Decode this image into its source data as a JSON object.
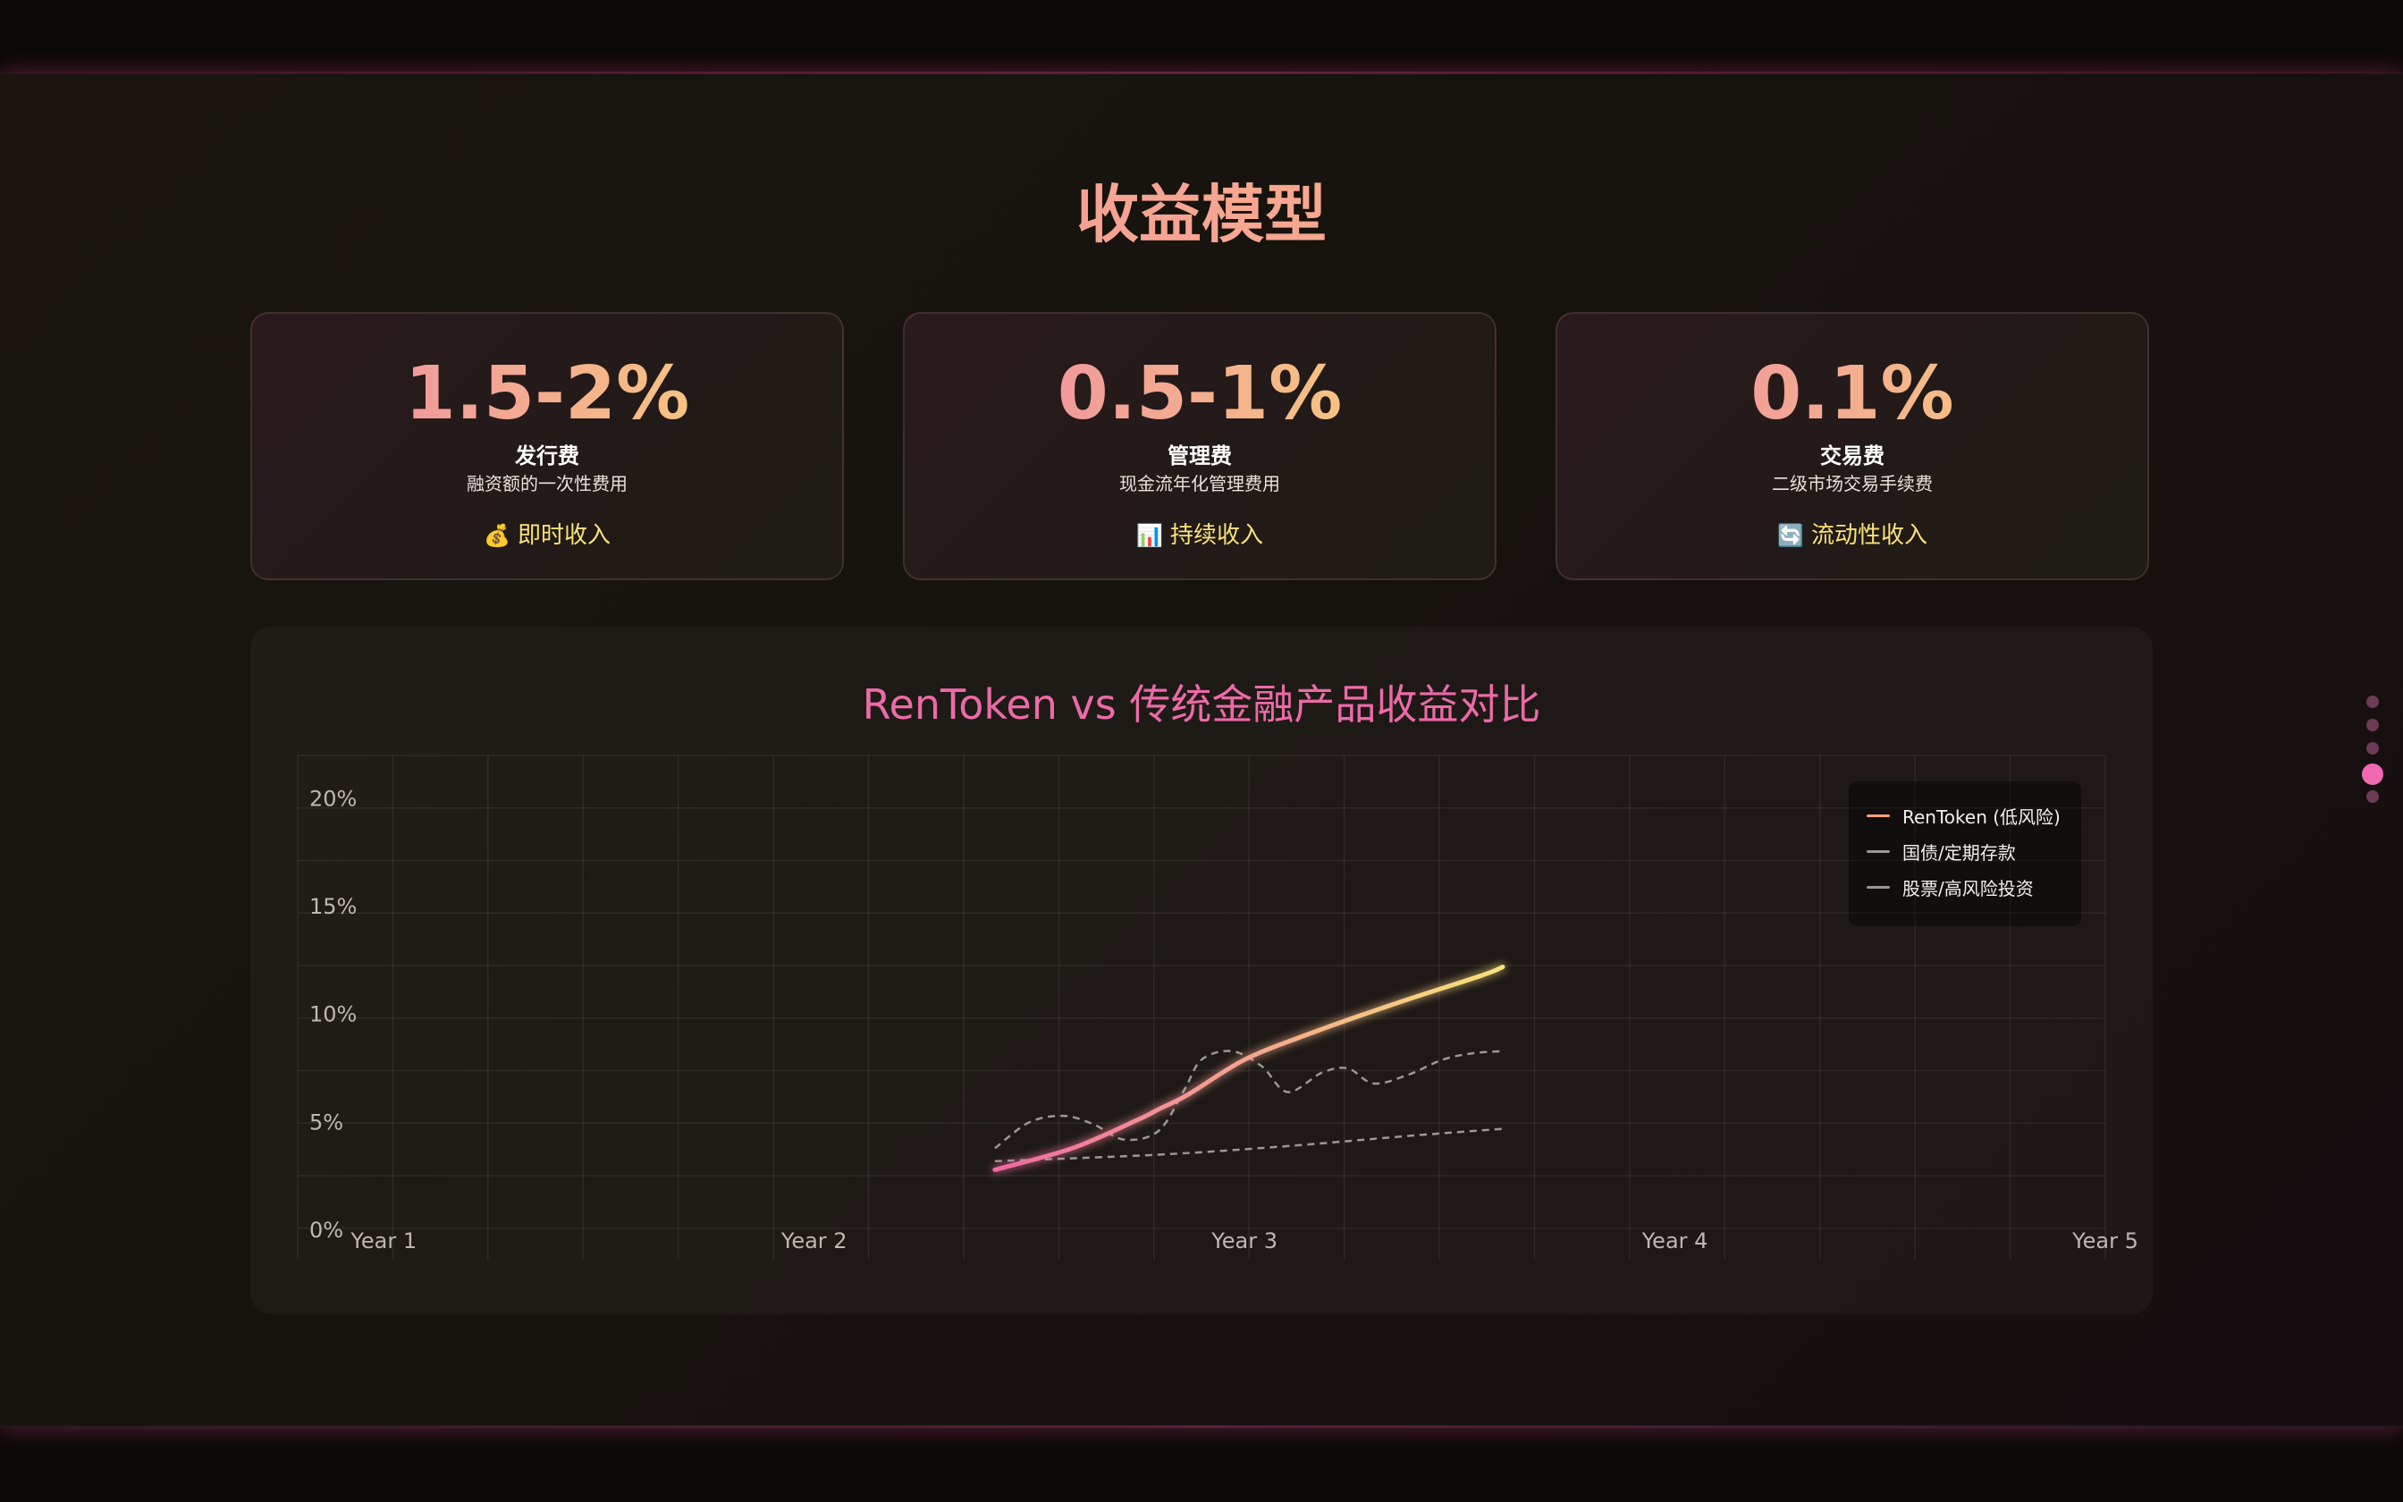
{
  "page": {
    "title": "收益模型"
  },
  "cards": [
    {
      "value": "1.5-2%",
      "name": "发行费",
      "desc": "融资额的一次性费用",
      "tag_icon": "💰",
      "tag": "即时收入"
    },
    {
      "value": "0.5-1%",
      "name": "管理费",
      "desc": "现金流年化管理费用",
      "tag_icon": "📊",
      "tag": "持续收入"
    },
    {
      "value": "0.1%",
      "name": "交易费",
      "desc": "二级市场交易手续费",
      "tag_icon": "🔄",
      "tag": "流动性收入"
    }
  ],
  "chart_data": {
    "type": "line",
    "title": "RenToken vs 传统金融产品收益对比",
    "x_ticks": [
      "Year 1",
      "Year 2",
      "Year 3",
      "Year 4",
      "Year 5"
    ],
    "y_ticks": [
      "0%",
      "5%",
      "10%",
      "15%",
      "20%"
    ],
    "ylim": [
      0,
      22
    ],
    "grid": true,
    "legend_position": "top-right",
    "series": [
      {
        "name": "RenToken (低风险)",
        "color": "#f6a07a",
        "gradient": [
          "#f06aa2",
          "#f9e27a"
        ],
        "dashed": false,
        "x": [
          2.42,
          2.6,
          2.75,
          2.8,
          2.87,
          3.0,
          3.15,
          3.35,
          3.55,
          3.6
        ],
        "y": [
          2.8,
          3.8,
          5.1,
          5.6,
          6.3,
          7.9,
          9.1,
          10.5,
          11.8,
          12.2
        ]
      },
      {
        "name": "国债/定期存款",
        "color": "#9a9894",
        "dashed": true,
        "x": [
          2.42,
          2.8,
          3.1,
          3.4,
          3.6
        ],
        "y": [
          3.2,
          3.5,
          3.9,
          4.4,
          4.7
        ]
      },
      {
        "name": "股票/高风险投资",
        "color": "#9a9894",
        "dashed": true,
        "x": [
          2.42,
          2.5,
          2.58,
          2.65,
          2.72,
          2.8,
          2.86,
          2.9,
          2.97,
          3.04,
          3.1,
          3.18,
          3.24,
          3.3,
          3.38,
          3.46,
          3.53,
          3.6
        ],
        "y": [
          3.8,
          5.0,
          5.3,
          4.9,
          4.2,
          4.6,
          6.5,
          7.9,
          8.3,
          7.6,
          6.4,
          7.3,
          7.5,
          6.8,
          7.2,
          7.9,
          8.2,
          8.3
        ]
      }
    ]
  },
  "nav": {
    "dot_count": 5,
    "active_index": 3
  }
}
